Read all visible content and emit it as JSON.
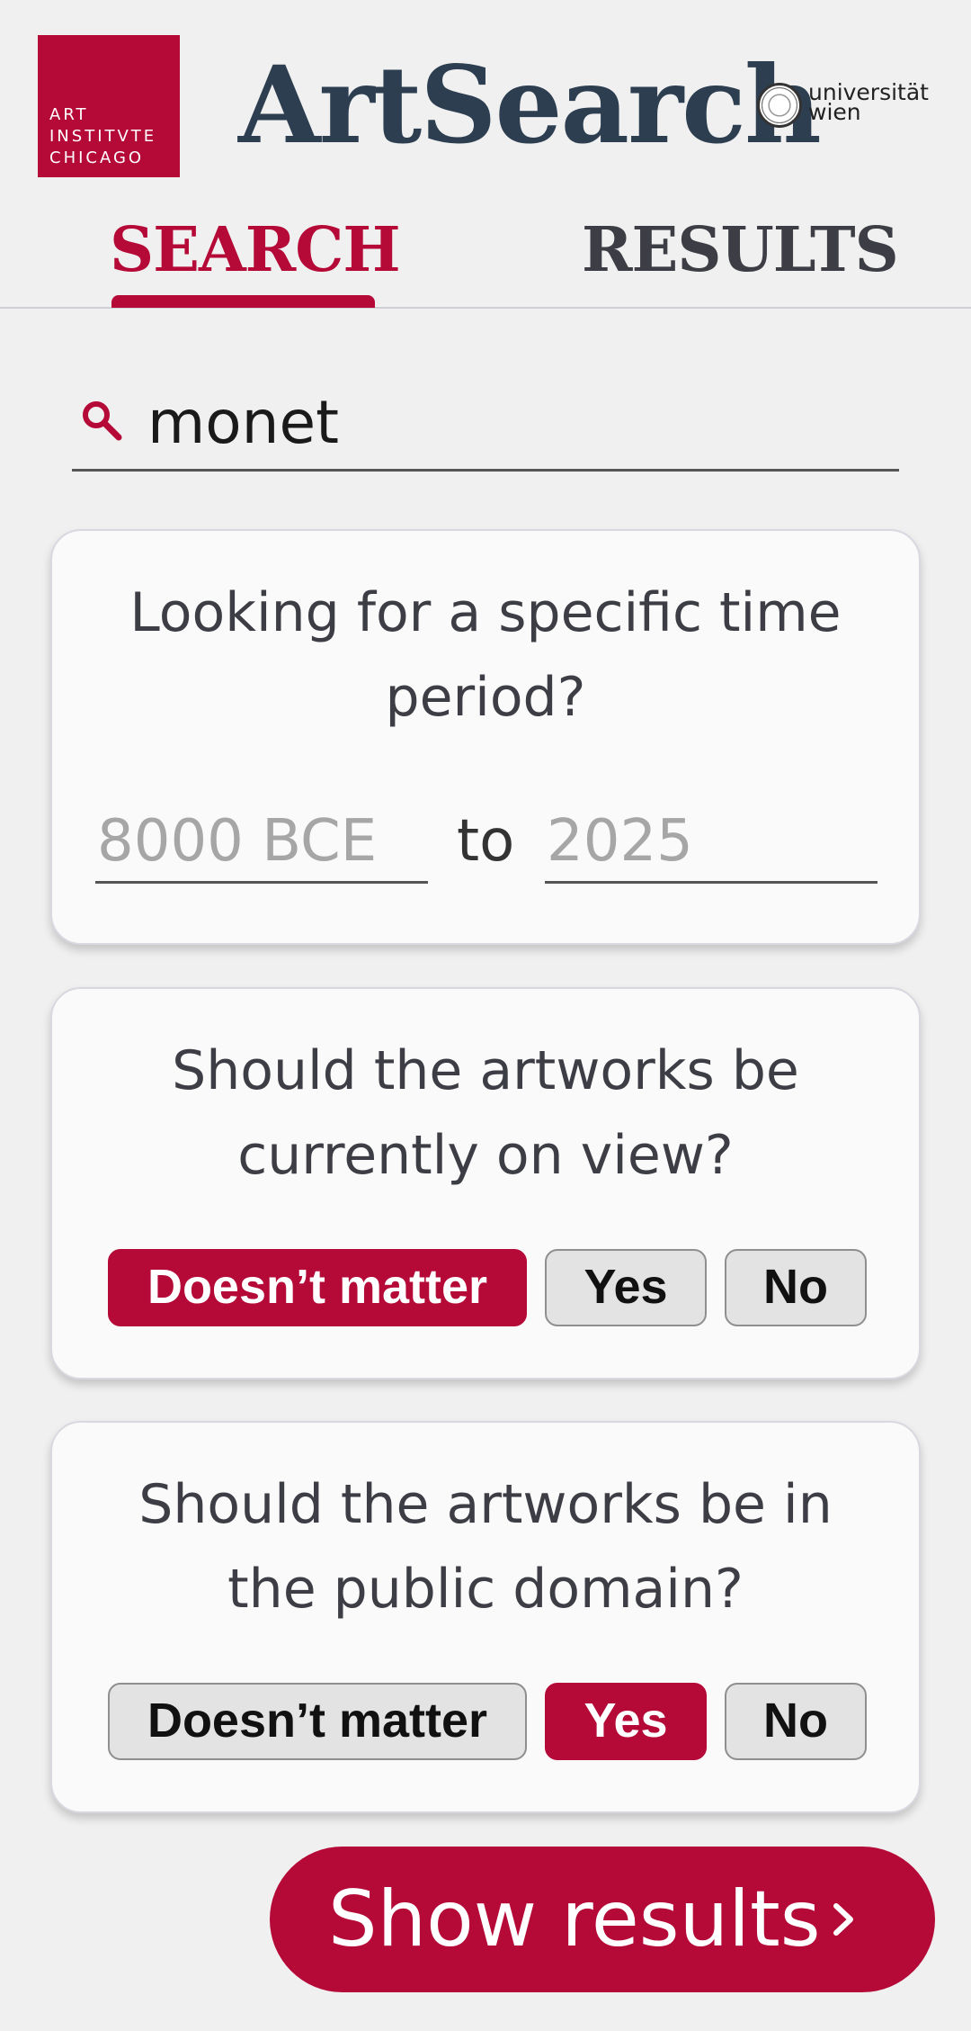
{
  "header": {
    "institution_logo_lines": [
      "ART",
      "INSTITVTE",
      "CHICAGO"
    ],
    "app_title": "ArtSearch",
    "university_lines": [
      "universität",
      "wien"
    ]
  },
  "tabs": [
    {
      "label": "SEARCH",
      "active": true
    },
    {
      "label": "RESULTS",
      "active": false
    }
  ],
  "search": {
    "value": "monet",
    "icon": "search-icon"
  },
  "time_period": {
    "question": "Looking for a specific time period?",
    "from_placeholder": "8000 BCE",
    "to_label": "to",
    "to_placeholder": "2025"
  },
  "on_view": {
    "question": "Should the artworks be currently on view?",
    "options": [
      "Doesn’t matter",
      "Yes",
      "No"
    ],
    "selected": "Doesn’t matter"
  },
  "public_domain": {
    "question": "Should the artworks be in the public domain?",
    "options": [
      "Doesn’t matter",
      "Yes",
      "No"
    ],
    "selected": "Yes"
  },
  "show_results": {
    "label": "Show results",
    "icon": "chevron-right-icon"
  },
  "colors": {
    "accent": "#b50938",
    "title": "#2c3e50",
    "background": "#f0f0f0"
  }
}
